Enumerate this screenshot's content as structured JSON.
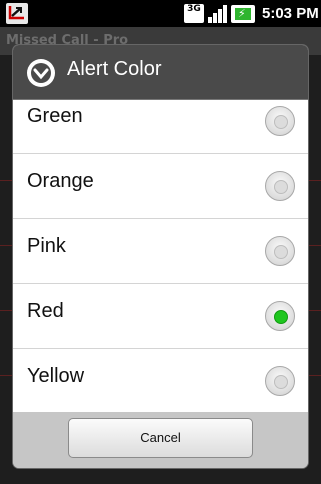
{
  "status_bar": {
    "network": "3G",
    "time": "5:03 PM",
    "icons": [
      "missed-call-app-icon",
      "3g-icon",
      "signal-icon",
      "battery-charging-icon"
    ]
  },
  "app": {
    "title": "Missed Call - Pro"
  },
  "dialog": {
    "title": "Alert Color",
    "options": [
      {
        "label": "Green",
        "selected": false
      },
      {
        "label": "Orange",
        "selected": false
      },
      {
        "label": "Pink",
        "selected": false
      },
      {
        "label": "Red",
        "selected": true
      },
      {
        "label": "Yellow",
        "selected": false
      }
    ],
    "cancel_label": "Cancel"
  },
  "colors": {
    "selected_radio": "#1ec61e",
    "header": "#4a4a4a"
  }
}
